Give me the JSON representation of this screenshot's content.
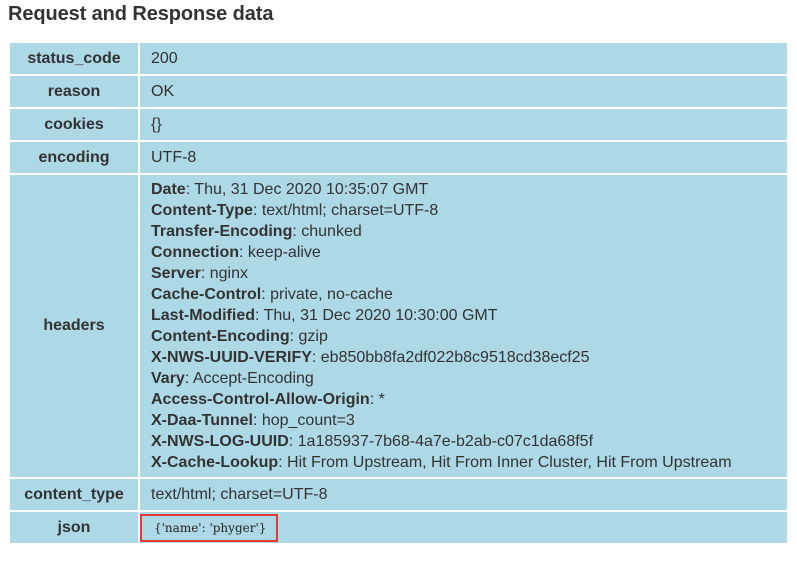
{
  "page": {
    "title": "Request and Response data"
  },
  "table": {
    "status_code": {
      "key": "status_code",
      "value": "200"
    },
    "reason": {
      "key": "reason",
      "value": "OK"
    },
    "cookies": {
      "key": "cookies",
      "value": "{}"
    },
    "encoding": {
      "key": "encoding",
      "value": "UTF-8"
    },
    "headers": {
      "key": "headers",
      "items": [
        {
          "name": "Date",
          "value": "Thu, 31 Dec 2020 10:35:07 GMT"
        },
        {
          "name": "Content-Type",
          "value": "text/html; charset=UTF-8"
        },
        {
          "name": "Transfer-Encoding",
          "value": "chunked"
        },
        {
          "name": "Connection",
          "value": "keep-alive"
        },
        {
          "name": "Server",
          "value": "nginx"
        },
        {
          "name": "Cache-Control",
          "value": "private, no-cache"
        },
        {
          "name": "Last-Modified",
          "value": "Thu, 31 Dec 2020 10:30:00 GMT"
        },
        {
          "name": "Content-Encoding",
          "value": "gzip"
        },
        {
          "name": "X-NWS-UUID-VERIFY",
          "value": "eb850bb8fa2df022b8c9518cd38ecf25"
        },
        {
          "name": "Vary",
          "value": "Accept-Encoding"
        },
        {
          "name": "Access-Control-Allow-Origin",
          "value": "*"
        },
        {
          "name": "X-Daa-Tunnel",
          "value": "hop_count=3"
        },
        {
          "name": "X-NWS-LOG-UUID",
          "value": "1a185937-7b68-4a7e-b2ab-c07c1da68f5f"
        },
        {
          "name": "X-Cache-Lookup",
          "value": "Hit From Upstream, Hit From Inner Cluster, Hit From Upstream"
        }
      ]
    },
    "content_type": {
      "key": "content_type",
      "value": "text/html; charset=UTF-8"
    },
    "json": {
      "key": "json",
      "value": "{'name': 'phyger'}"
    }
  },
  "colors": {
    "cell_background": "#add8e6",
    "highlight_border": "#e53935"
  }
}
